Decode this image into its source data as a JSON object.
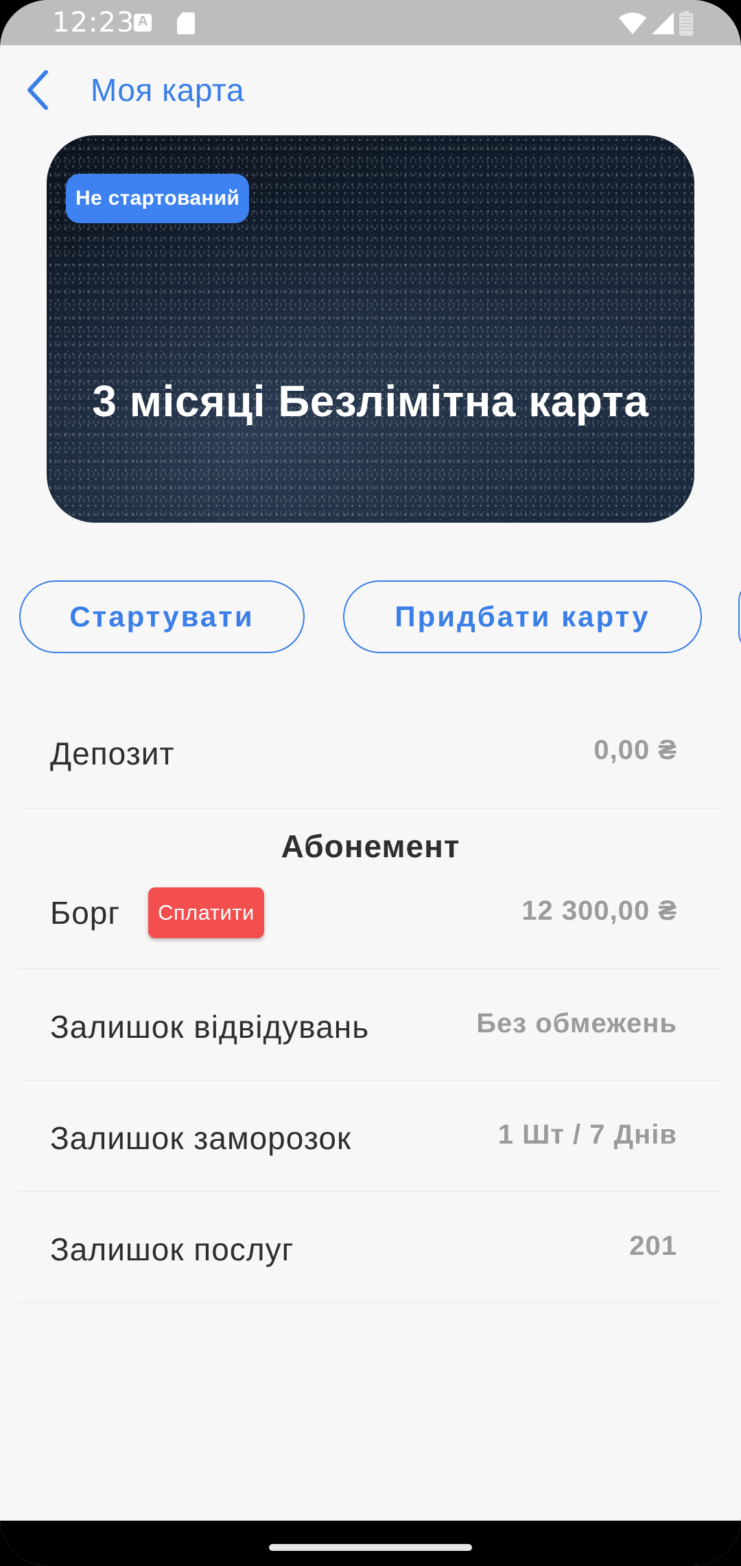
{
  "status_bar": {
    "time": "12:23",
    "icons": [
      "keyboard-a-icon",
      "sd-card-icon",
      "wifi-icon",
      "signal-icon",
      "battery-icon"
    ]
  },
  "header": {
    "title": "Моя карта",
    "back_icon": "chevron-left-icon"
  },
  "card": {
    "badge": "Не стартований",
    "title": "3 місяці Безлімітна карта"
  },
  "actions": {
    "start_label": "Стартувати",
    "buy_label": "Придбати карту"
  },
  "info": {
    "deposit": {
      "label": "Депозит",
      "value": "0,00 ₴"
    },
    "section_title": "Абонемент",
    "debt": {
      "label": "Борг",
      "pay_label": "Сплатити",
      "value": "12 300,00 ₴"
    },
    "visits": {
      "label": "Залишок відвідувань",
      "value": "Без обмежень"
    },
    "freeze": {
      "label": "Залишок заморозок",
      "value": "1 Шт / 7 Днів"
    },
    "services": {
      "label": "Залишок послуг",
      "value": "201"
    }
  },
  "colors": {
    "accent": "#3a7ee8",
    "badge": "#3d82f0",
    "danger": "#f34f4f",
    "value_text": "#9b9b9b",
    "background": "#f7f7f7"
  }
}
